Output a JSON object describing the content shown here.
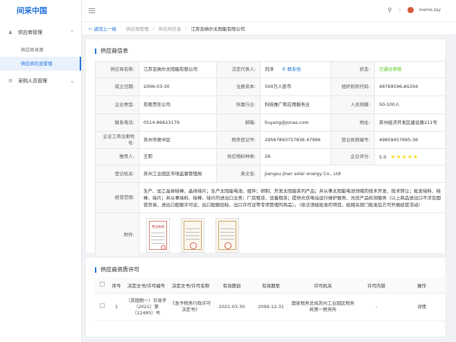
{
  "app": {
    "logo": "间采中国"
  },
  "sidebar": {
    "groups": [
      {
        "label": "供应商管理",
        "icon": "user-icon",
        "expanded": true,
        "items": [
          {
            "label": "供应商寻源",
            "active": false
          },
          {
            "label": "供应商信息管理",
            "active": true
          }
        ]
      },
      {
        "label": "采购人员管理",
        "icon": "settings-icon",
        "expanded": false,
        "items": []
      }
    ]
  },
  "topbar": {
    "username": "meme.zay"
  },
  "breadcrumb": {
    "back": "返回上一级",
    "items": [
      "供应商管理",
      "供应商信息"
    ],
    "current": "江苏吉纳尔太阳能有限公司"
  },
  "supplier": {
    "section_title": "供应商信息",
    "labels": {
      "name": "供应商名称:",
      "legal_rep": "法定代表人:",
      "status": "状态:",
      "founded": "成立日期:",
      "capital": "注册资本:",
      "org_code": "组织机构代码:",
      "type": "企业类型:",
      "industry": "所属行业:",
      "staff": "人员规模:",
      "phone": "联系电话:",
      "email": "邮箱:",
      "address": "地址:",
      "reg_address": "企业工商注册地址:",
      "tax_no": "税务登记号:",
      "license_no": "营业执照编号:",
      "recommender": "推荐人:",
      "material_count": "供应物料种类:",
      "score": "企业评分:",
      "authority": "登记机关:",
      "english_name": "英文名:",
      "scope": "经营范围:",
      "attachments": "附件:"
    },
    "values": {
      "name": "江苏吉纳尔太阳能有限公司",
      "legal_rep": "刘洋",
      "contact_link": "联系他",
      "status": "已通过审核",
      "founded": "2006-03-30",
      "capital": "500万人民币",
      "org_code": "48769596-AS356",
      "type": "有限责任公司",
      "industry": "科技推广和应用服务业",
      "staff": "50-100人",
      "phone": "0514-86623179",
      "email": "liuyang@jonas.com",
      "address": "苏州经济开发区建设路211号",
      "reg_address": "苏州市吴中区",
      "tax_no": "29567893757836 47996",
      "license_no": "49859457695-36",
      "recommender": "王莉",
      "material_count": "26",
      "score": "5.0",
      "authority": "苏州工业园区市场监督管理局",
      "english_name": "Jiangsu Jiner solar energy Co., Ltd",
      "scope": "生产、加工晶体硅棒、晶体硅片；生产太阳能电池、组件；研制、开发太阳能系列产品；并从事太阳能电池领域的技术开发、技术转让；批发硅料、硅棒、硅片；并从事硅料、硅棒、硅片的进出口业务；厂房租赁、设备租赁；提供光伏电站运行维护服务、光伏产品检测服务（以上商品进出口不涉及国营贸易、进出口配额许可证、出口配额招标、出口许可证等专项管理的商品）。（依法须经批准的项目，经相关部门批准后方可开展经营活动）"
    },
    "rating_stars": 5,
    "attachments": [
      {
        "type": "business-license",
        "caption": "营业执照"
      },
      {
        "type": "certificate"
      },
      {
        "type": "certificate"
      }
    ]
  },
  "qualification": {
    "section_title": "供应商资质许可",
    "columns": [
      "序号",
      "决定文书/许可编号",
      "决定文书/许可名称",
      "有效期自",
      "有效期至",
      "许可机关",
      "许可内容",
      "操作"
    ],
    "rows": [
      {
        "index": "1",
        "doc_no": "（苏国税一）许准字（2021）第（12485）号",
        "doc_name": "《准予税务行政许可决定书》",
        "from": "2021-03-30",
        "to": "2099-12-31",
        "authority": "国家税务总局苏州工业园区税务局第一税务所",
        "content": "-",
        "action": "详情"
      }
    ]
  },
  "colors": {
    "primary": "#1e6fd9",
    "success": "#52c41a",
    "star": "#fadb14"
  }
}
